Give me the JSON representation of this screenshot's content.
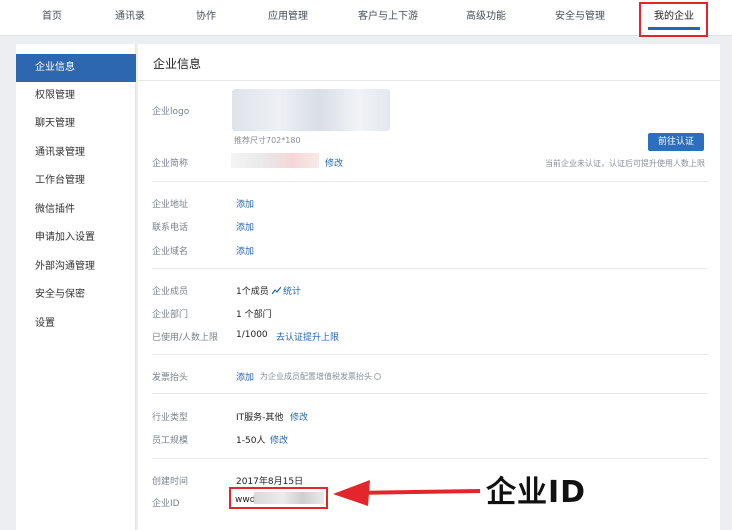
{
  "nav": {
    "items": [
      "首页",
      "通讯录",
      "协作",
      "应用管理",
      "客户与上下游",
      "高级功能",
      "安全与管理",
      "我的企业"
    ],
    "active": "我的企业"
  },
  "sidebar": {
    "items": [
      "企业信息",
      "权限管理",
      "聊天管理",
      "通讯录管理",
      "工作台管理",
      "微信插件",
      "申请加入设置",
      "外部沟通管理",
      "安全与保密",
      "设置"
    ],
    "active": "企业信息"
  },
  "main": {
    "title": "企业信息",
    "logo": {
      "label": "企业logo",
      "size_hint": "推荐尺寸702*180"
    },
    "short_name": {
      "label": "企业简称",
      "action": "修改"
    },
    "verify": {
      "button": "前往认证",
      "hint": "当前企业未认证，认证后可提升使用人数上限"
    },
    "address": {
      "label": "企业地址",
      "action": "添加"
    },
    "phone": {
      "label": "联系电话",
      "action": "添加"
    },
    "domain": {
      "label": "企业域名",
      "action": "添加"
    },
    "members": {
      "label": "企业成员",
      "value": "1个成员",
      "action": "统计"
    },
    "departments": {
      "label": "企业部门",
      "value": "1 个部门"
    },
    "usage": {
      "label": "已使用/人数上限",
      "value": "1/1000",
      "action": "去认证提升上限"
    },
    "invoice": {
      "label": "发票抬头",
      "action": "添加",
      "hint": "为企业成员配置增值税发票抬头"
    },
    "industry": {
      "label": "行业类型",
      "value": "IT服务-其他",
      "action": "修改"
    },
    "scale": {
      "label": "员工规模",
      "value": "1-50人",
      "action": "修改"
    },
    "created": {
      "label": "创建时间",
      "value": "2017年8月15日"
    },
    "corp_id": {
      "label": "企业ID",
      "value_prefix": "wwdc"
    }
  },
  "annotation": {
    "text": "企业ID",
    "color": "#e3262c"
  },
  "colors": {
    "accent": "#2c67b0",
    "link": "#2466ad",
    "highlight": "#e3262c"
  }
}
